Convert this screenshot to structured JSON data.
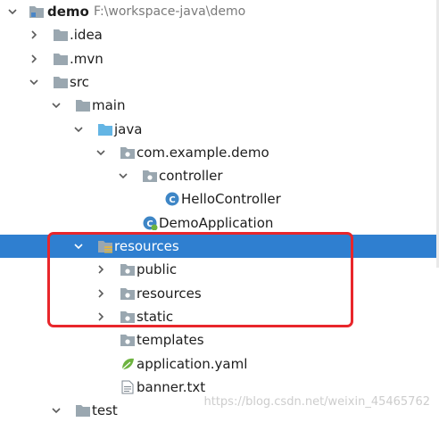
{
  "project": {
    "name": "demo",
    "path": "F:\\workspace-java\\demo"
  },
  "tree": [
    {
      "label": "demo",
      "depth": 0,
      "expanded": true,
      "icon": "module-folder-icon",
      "bold": true,
      "path": true
    },
    {
      "label": ".idea",
      "depth": 1,
      "expanded": false,
      "icon": "folder-icon"
    },
    {
      "label": ".mvn",
      "depth": 1,
      "expanded": false,
      "icon": "folder-icon"
    },
    {
      "label": "src",
      "depth": 1,
      "expanded": true,
      "icon": "folder-icon"
    },
    {
      "label": "main",
      "depth": 2,
      "expanded": true,
      "icon": "folder-icon"
    },
    {
      "label": "java",
      "depth": 3,
      "expanded": true,
      "icon": "source-root-icon"
    },
    {
      "label": "com.example.demo",
      "depth": 4,
      "expanded": true,
      "icon": "package-icon"
    },
    {
      "label": "controller",
      "depth": 5,
      "expanded": true,
      "icon": "package-icon"
    },
    {
      "label": "HelloController",
      "depth": 6,
      "icon": "class-icon"
    },
    {
      "label": "DemoApplication",
      "depth": 5,
      "icon": "spring-class-icon"
    },
    {
      "label": "resources",
      "depth": 3,
      "expanded": true,
      "icon": "resources-root-icon",
      "selected": true
    },
    {
      "label": "public",
      "depth": 4,
      "expanded": false,
      "icon": "package-icon"
    },
    {
      "label": "resources",
      "depth": 4,
      "expanded": false,
      "icon": "package-icon"
    },
    {
      "label": "static",
      "depth": 4,
      "expanded": false,
      "icon": "package-icon"
    },
    {
      "label": "templates",
      "depth": 4,
      "icon": "package-icon"
    },
    {
      "label": "application.yaml",
      "depth": 4,
      "icon": "spring-config-icon"
    },
    {
      "label": "banner.txt",
      "depth": 4,
      "icon": "text-file-icon"
    },
    {
      "label": "test",
      "depth": 2,
      "expanded": true,
      "icon": "folder-icon"
    }
  ],
  "watermark": "https://blog.csdn.net/weixin_45465762",
  "colors": {
    "selection": "#2f7fd0",
    "highlight_border": "#e8262b"
  }
}
